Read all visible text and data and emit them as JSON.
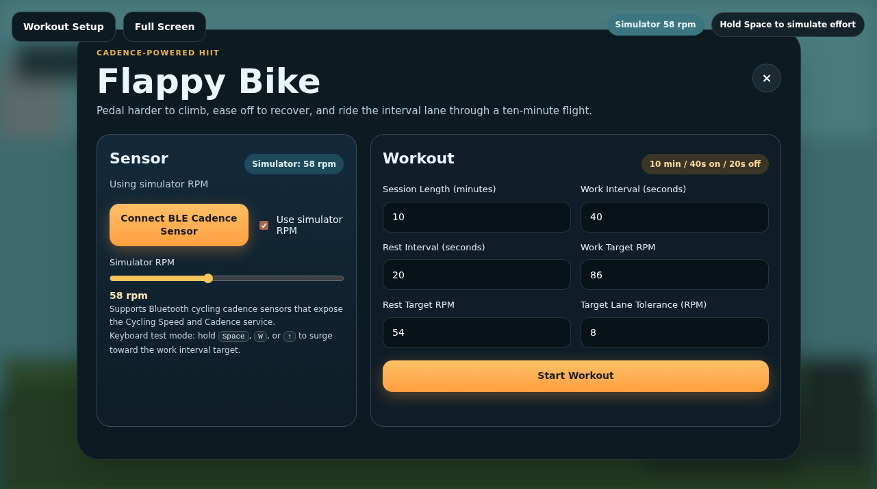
{
  "top_bar": {
    "buttons": [
      "Workout Setup",
      "Full Screen"
    ],
    "status_pill": "Simulator 58 rpm",
    "hint_pill": "Hold Space to simulate effort"
  },
  "dialog": {
    "eyebrow": "CADENCE-POWERED HIIT",
    "title": "Flappy Bike",
    "close": "×",
    "subtitle": "Pedal harder to climb, ease off to recover, and ride the interval lane through a ten-minute flight.",
    "sensor": {
      "title": "Sensor",
      "badge": "Simulator: 58 rpm",
      "status": "Using simulator RPM",
      "connect_button": "Connect BLE Cadence Sensor",
      "simulator_toggle": {
        "label": "Use simulator RPM",
        "checked": true
      },
      "slider": {
        "label": "Simulator RPM",
        "level": 0.42,
        "reading": "58 rpm"
      },
      "help": "Supports Bluetooth cycling cadence sensors that expose the Cycling Speed and Cadence service.",
      "keyboard_help": [
        {
          "kind": "text",
          "text": "Keyboard test mode: hold "
        },
        {
          "kind": "key",
          "text": "Space"
        },
        {
          "kind": "text",
          "text": ", "
        },
        {
          "kind": "key",
          "text": "W"
        },
        {
          "kind": "text",
          "text": ", or "
        },
        {
          "kind": "key",
          "text": "↑"
        },
        {
          "kind": "text",
          "text": " to surge toward the work interval target."
        }
      ]
    },
    "workout": {
      "title": "Workout",
      "badge": "10 min / 40s on / 20s off",
      "fields": [
        {
          "label": "Session Length (minutes)",
          "value": "10"
        },
        {
          "label": "Work Interval (seconds)",
          "value": "40"
        },
        {
          "label": "Rest Interval (seconds)",
          "value": "20"
        },
        {
          "label": "Work Target RPM",
          "value": "86"
        },
        {
          "label": "Rest Target RPM",
          "value": "54"
        },
        {
          "label": "Target Lane Tolerance (RPM)",
          "value": "8"
        }
      ],
      "start_button": "Start Workout"
    }
  }
}
